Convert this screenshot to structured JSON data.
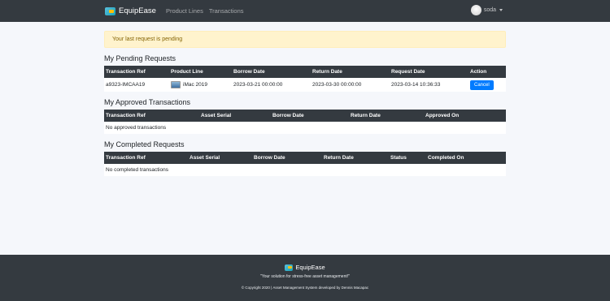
{
  "navbar": {
    "brand": "EquipEase",
    "links": [
      "Product Lines",
      "Transactions"
    ],
    "username": "soda"
  },
  "alert": {
    "text": "Your last request is pending"
  },
  "pending": {
    "title": "My Pending Requests",
    "headers": [
      "Transaction Ref",
      "Product Line",
      "Borrow Date",
      "Return Date",
      "Request Date",
      "Action"
    ],
    "row": {
      "ref": "a9323-IMCAA19",
      "product": "iMac 2019",
      "borrow": "2023-03-21 00:00:00",
      "return": "2023-03-30 00:00:00",
      "request": "2023-03-14 10:36:33",
      "action": "Cancel"
    }
  },
  "approved": {
    "title": "My Approved Transactions",
    "headers": [
      "Transaction Ref",
      "Asset Serial",
      "Borrow Date",
      "Return Date",
      "Approved On"
    ],
    "empty": "No approved transactions"
  },
  "completed": {
    "title": "My Completed Requests",
    "headers": [
      "Transaction Ref",
      "Asset Serial",
      "Borrow Date",
      "Return Date",
      "Status",
      "Completed On"
    ],
    "empty": "No completed transactions"
  },
  "footer": {
    "brand": "EquipEase",
    "tagline": "\"Your solution for stress-free asset management!\"",
    "copyright": "© Copyright 2020 | Asset Management System developed by Dennis Macapac"
  },
  "colors": {
    "navbar": "#343a40",
    "primary": "#007bff",
    "alert_bg": "#fff3cd"
  }
}
